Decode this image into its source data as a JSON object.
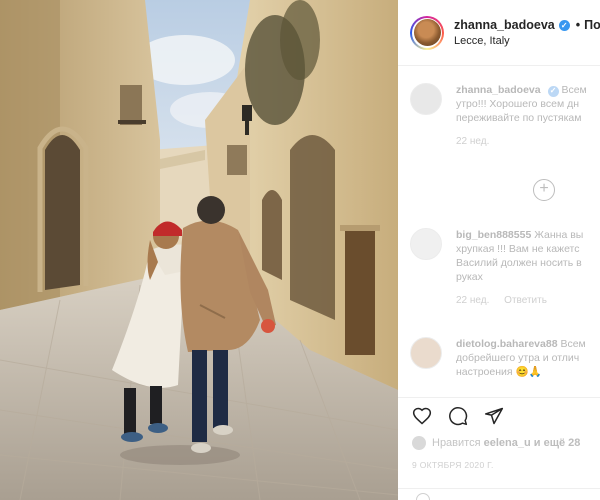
{
  "header": {
    "username": "zhanna_badoeva",
    "follow_label": "Подп",
    "location": "Lecce, Italy"
  },
  "comments": [
    {
      "username": "zhanna_badoeva",
      "lines": [
        "Всем",
        "утро!!! Хорошего всем дн",
        "переживайте по пустякам"
      ],
      "time": "22 нед."
    },
    {
      "username": "big_ben888555",
      "lines": [
        "Жанна вы",
        "хрупкая !!! Вам не кажетс",
        "Василий должен носить в",
        "руках"
      ],
      "time": "22 нед.",
      "reply_label": "Ответить"
    },
    {
      "username": "dietolog.bahareva88",
      "lines": [
        "Всем",
        "добрейшего утра и отлич",
        "настроения 😊🙏"
      ]
    }
  ],
  "load_more_symbol": "+",
  "likes": {
    "prefix": "Нравится",
    "user": "eelena_u",
    "suffix": "и ещё 28"
  },
  "post_date": "9 ОКТЯБРЯ 2020 Г.",
  "icons": [
    "heart-icon",
    "comment-icon",
    "share-icon"
  ],
  "colors": {
    "verified": "#3897f0",
    "muted_text": "#b8b8b8"
  }
}
